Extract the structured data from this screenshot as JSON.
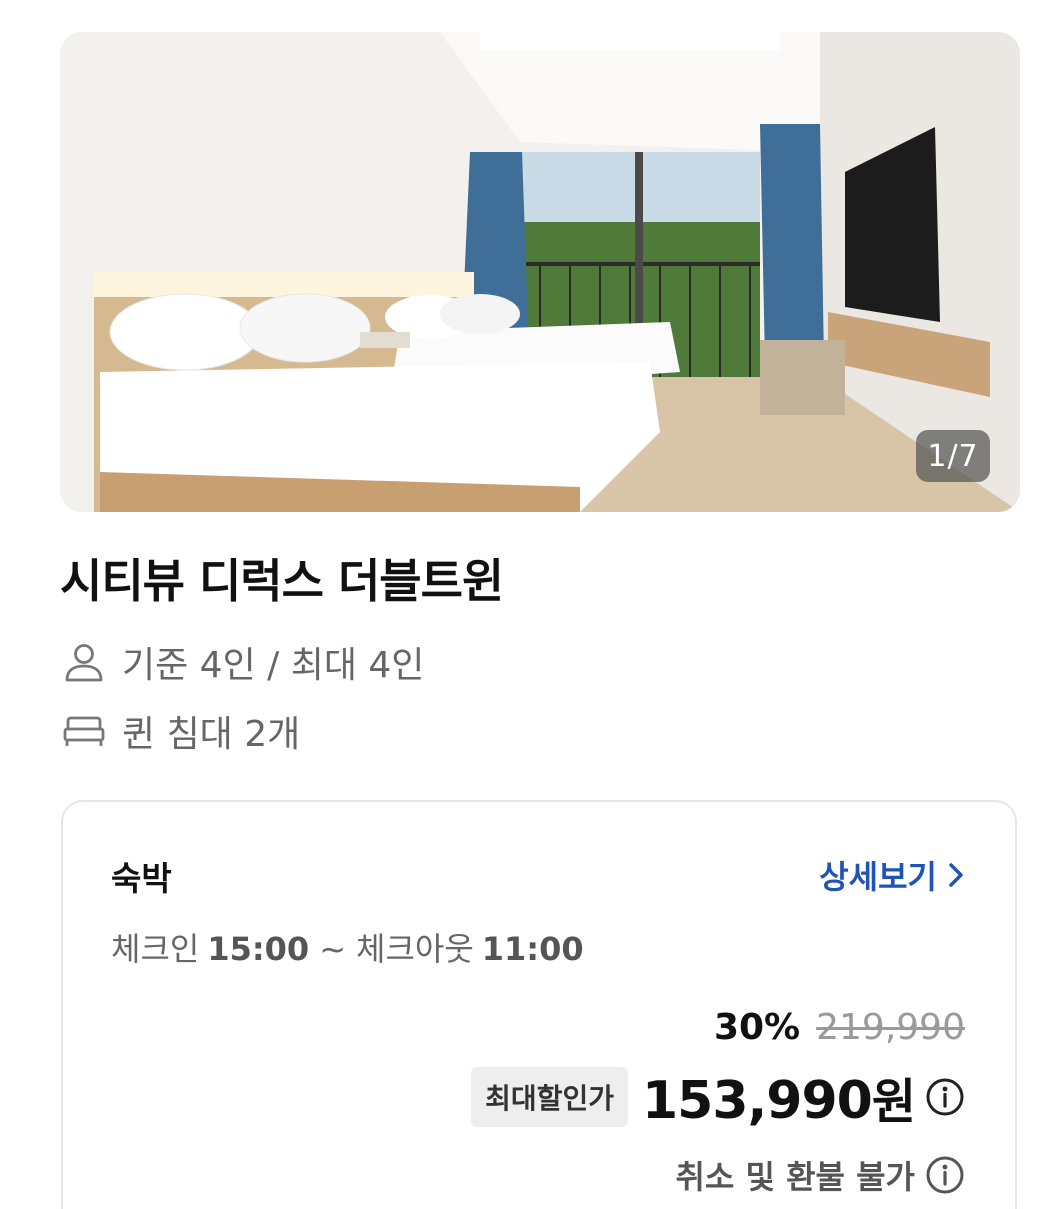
{
  "photo": {
    "counter": "1/7"
  },
  "room": {
    "title": "시티뷰 디럭스 더블트윈",
    "capacity_text": "기준 4인 / 최대 4인",
    "capacity_icon": "person-icon",
    "bed_text": "퀸 침대 2개",
    "bed_icon": "bed-icon"
  },
  "stay": {
    "label": "숙박",
    "detail_link": "상세보기",
    "checkin_label": "체크인",
    "checkin_time": "15:00",
    "separator": "~",
    "checkout_label": "체크아웃",
    "checkout_time": "11:00"
  },
  "price": {
    "discount_rate": "30%",
    "original_price": "219,990",
    "badge": "최대할인가",
    "final_price": "153,990",
    "currency": "원",
    "refund_policy": "취소 및 환불 불가"
  },
  "colors": {
    "link": "#1f55b8",
    "strike": "#9a9a9a",
    "badge_bg": "#eeeeee"
  }
}
